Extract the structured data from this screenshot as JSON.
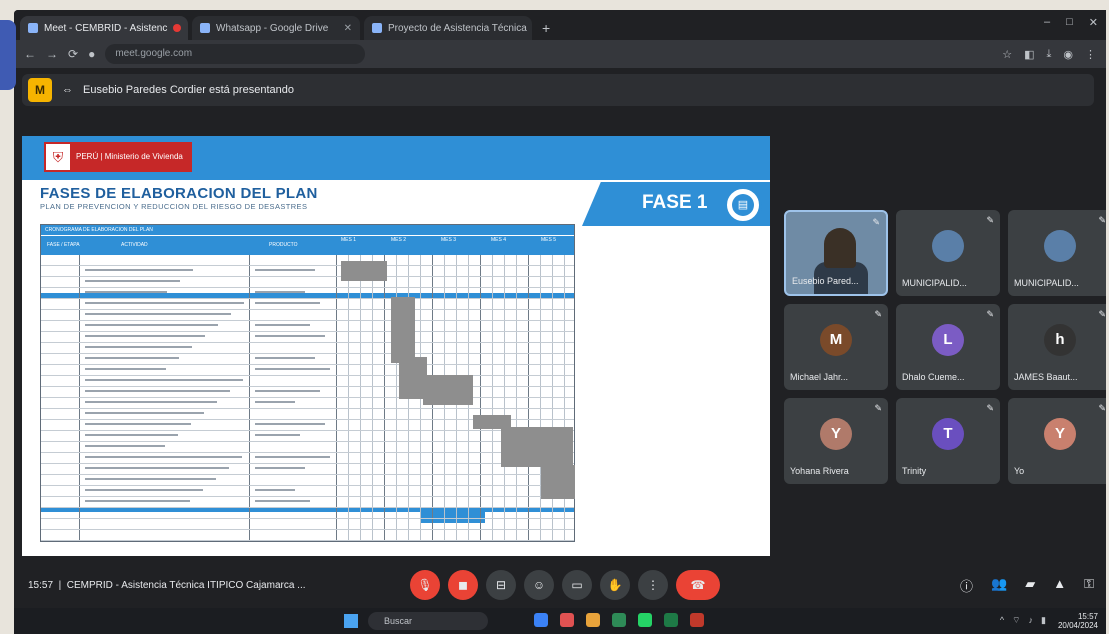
{
  "browser": {
    "tabs": [
      {
        "label": "Meet - CEMBRID - Asistenc",
        "active": true
      },
      {
        "label": "Whatsapp - Google Drive",
        "active": false
      },
      {
        "label": "Proyecto de Asistencia Técnica",
        "active": false
      }
    ],
    "url": "meet.google.com",
    "window_controls": [
      "–",
      "□",
      "✕"
    ]
  },
  "notice": {
    "badge": "M",
    "text": "Eusebio Paredes Cordier está presentando"
  },
  "slide": {
    "logo_text": "PERÚ | Ministerio de Vivienda",
    "title": "FASES DE ELABORACION DEL PLAN",
    "subtitle": "PLAN DE PREVENCION Y REDUCCION DEL RIESGO DE DESASTRES",
    "phase_label": "FASE 1",
    "table_header": "CRONOGRAMA DE ELABORACION DEL PLAN",
    "columns": [
      "FASE / ETAPA",
      "ACTIVIDAD",
      "PRODUCTO",
      "MES 1",
      "MES 2",
      "MES 3",
      "MES 4",
      "MES 5"
    ]
  },
  "participants": [
    {
      "name": "Eusebio Pared...",
      "kind": "video"
    },
    {
      "name": "MUNICIPALID...",
      "kind": "avatar",
      "initial": "",
      "color": "#5a7fa8"
    },
    {
      "name": "MUNICIPALID...",
      "kind": "avatar",
      "initial": "",
      "color": "#5a7fa8"
    },
    {
      "name": "Michael Jahr...",
      "kind": "avatar",
      "initial": "M",
      "color": "#7a4a2a"
    },
    {
      "name": "Dhalo Cueme...",
      "kind": "avatar",
      "initial": "L",
      "color": "#7b5cc4"
    },
    {
      "name": "JAMES Baaut...",
      "kind": "avatar",
      "initial": "h",
      "color": "#333333"
    },
    {
      "name": "Yohana Rivera",
      "kind": "avatar",
      "initial": "Y",
      "color": "#b07a6a"
    },
    {
      "name": "Trinity",
      "kind": "avatar",
      "initial": "T",
      "color": "#6a4fbf"
    },
    {
      "name": "Yo",
      "kind": "avatar",
      "initial": "Y",
      "color": "#c9806e"
    }
  ],
  "meeting": {
    "time": "15:57",
    "title": "CEMPRID - Asistencia Técnica ITIPICO Cajamarca ..."
  },
  "taskbar": {
    "search_placeholder": "Buscar",
    "clock_time": "15:57",
    "clock_date": "20/04/2024"
  }
}
